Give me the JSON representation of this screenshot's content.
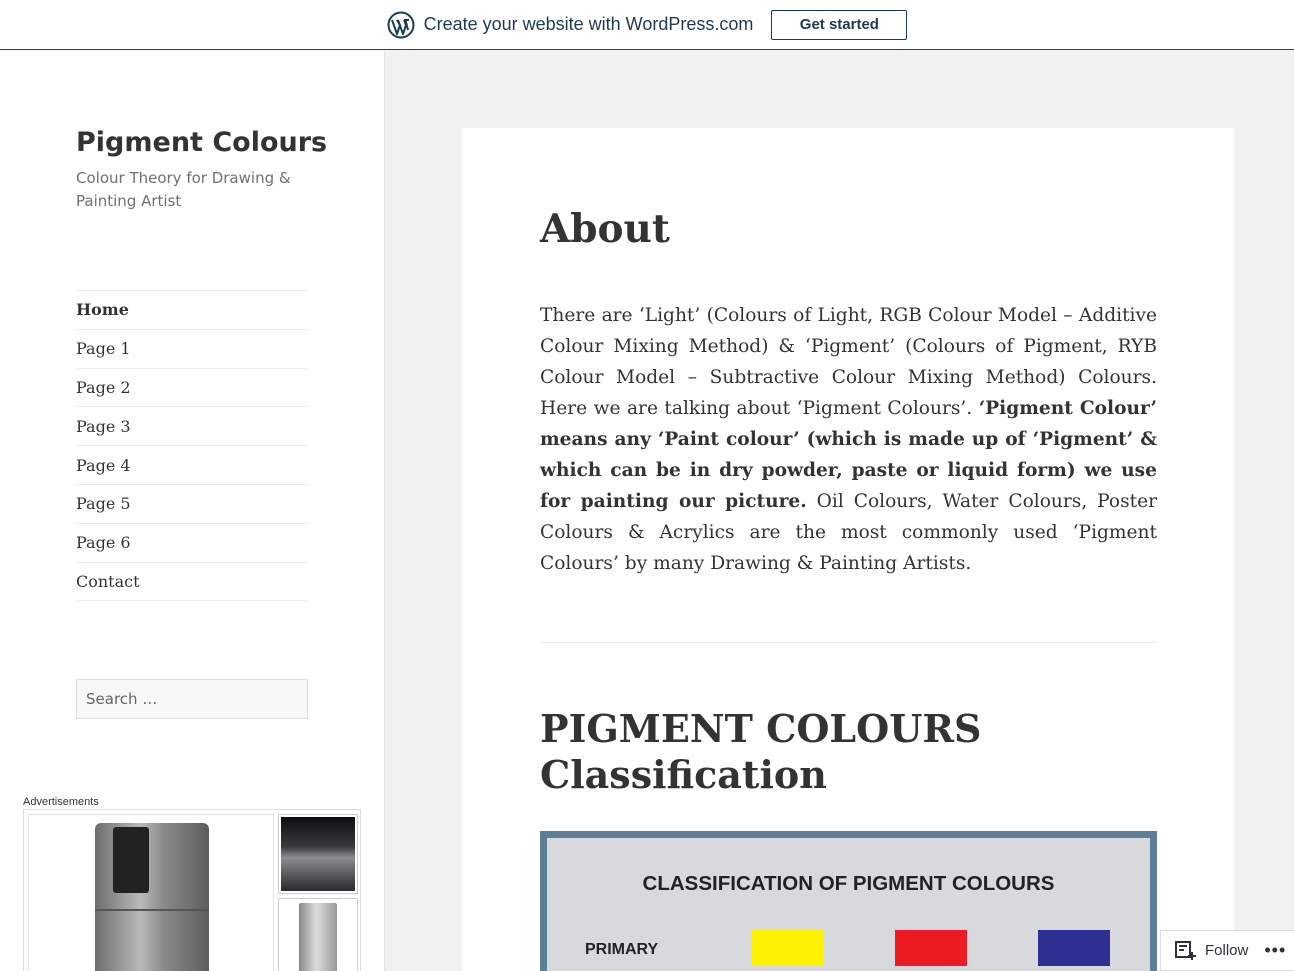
{
  "banner": {
    "text": "Create your website with WordPress.com",
    "cta": "Get started"
  },
  "site": {
    "title": "Pigment Colours",
    "description": "Colour Theory for Drawing & Painting Artist"
  },
  "nav": {
    "items": [
      "Home",
      "Page 1",
      "Page 2",
      "Page 3",
      "Page 4",
      "Page 5",
      "Page 6",
      "Contact"
    ]
  },
  "search": {
    "placeholder": "Search …"
  },
  "ads": {
    "label": "Advertisements"
  },
  "page": {
    "title": "About",
    "para_part1": "There are ‘Light’ (Colours of Light, RGB Colour Model – Additive Colour Mixing Method) & ‘Pigment’ (Colours of Pigment, RYB Colour Model – Subtractive Colour Mixing Method) Colours. Here we are talking about ‘Pigment Colours’. ",
    "para_bold": "‘Pigment Colour’ means any ‘Paint colour’ (which is made up of ‘Pigment’ & which can be in dry powder, paste or liquid form) we use for painting our picture.",
    "para_part2": " Oil Colours, Water Colours, Poster Colours & Acrylics are the most commonly used ‘Pigment Colours’ by many Drawing & Painting Artists.",
    "section_heading": "PIGMENT COLOURS Classification"
  },
  "figure": {
    "title": "CLASSIFICATION OF PIGMENT COLOURS",
    "row_label": "PRIMARY",
    "swatches": [
      "#fff200",
      "#ed1c24",
      "#2e3192"
    ]
  },
  "follow": {
    "label": "Follow",
    "more": "•••"
  }
}
